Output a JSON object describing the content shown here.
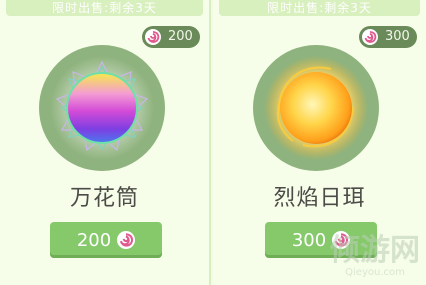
{
  "items": [
    {
      "banner": "限时出售:剩余3天",
      "badge_price": "200",
      "name": "万花筒",
      "button_price": "200"
    },
    {
      "banner": "限时出售:剩余3天",
      "badge_price": "300",
      "name": "烈焰日珥",
      "button_price": "300"
    }
  ],
  "watermark": {
    "title": "倾游网",
    "url": "Qieyou.com"
  },
  "icons": {
    "currency": "candy-icon"
  }
}
